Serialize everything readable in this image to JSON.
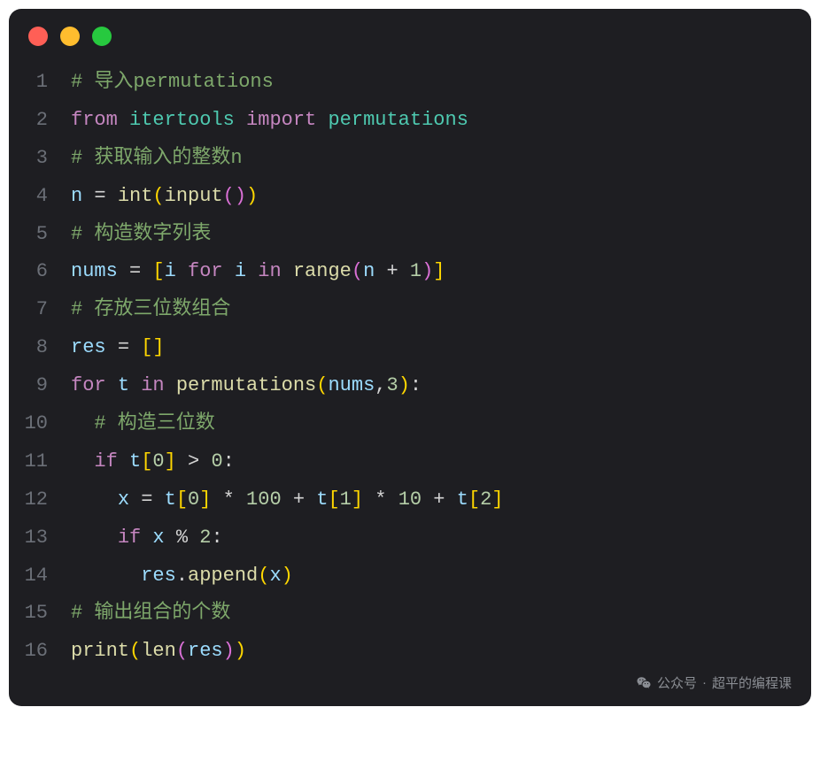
{
  "window": {
    "traffic_lights": [
      "close",
      "minimize",
      "zoom"
    ]
  },
  "watermark": {
    "prefix": "公众号",
    "separator": "·",
    "name": "超平的编程课"
  },
  "code": {
    "lines": [
      {
        "num": "1",
        "tokens": [
          {
            "cls": "tok-comment",
            "text": "# 导入permutations"
          }
        ]
      },
      {
        "num": "2",
        "tokens": [
          {
            "cls": "tok-keyword",
            "text": "from"
          },
          {
            "cls": "tok-default",
            "text": " "
          },
          {
            "cls": "tok-module",
            "text": "itertools"
          },
          {
            "cls": "tok-default",
            "text": " "
          },
          {
            "cls": "tok-keyword",
            "text": "import"
          },
          {
            "cls": "tok-default",
            "text": " "
          },
          {
            "cls": "tok-module",
            "text": "permutations"
          }
        ]
      },
      {
        "num": "3",
        "tokens": [
          {
            "cls": "tok-comment",
            "text": "# 获取输入的整数n"
          }
        ]
      },
      {
        "num": "4",
        "tokens": [
          {
            "cls": "tok-var",
            "text": "n"
          },
          {
            "cls": "tok-default",
            "text": " "
          },
          {
            "cls": "tok-op",
            "text": "="
          },
          {
            "cls": "tok-default",
            "text": " "
          },
          {
            "cls": "tok-builtin",
            "text": "int"
          },
          {
            "cls": "tok-bracket1",
            "text": "("
          },
          {
            "cls": "tok-builtin",
            "text": "input"
          },
          {
            "cls": "tok-bracket2",
            "text": "("
          },
          {
            "cls": "tok-bracket2",
            "text": ")"
          },
          {
            "cls": "tok-bracket1",
            "text": ")"
          }
        ]
      },
      {
        "num": "5",
        "tokens": [
          {
            "cls": "tok-comment",
            "text": "# 构造数字列表"
          }
        ]
      },
      {
        "num": "6",
        "tokens": [
          {
            "cls": "tok-var",
            "text": "nums"
          },
          {
            "cls": "tok-default",
            "text": " "
          },
          {
            "cls": "tok-op",
            "text": "="
          },
          {
            "cls": "tok-default",
            "text": " "
          },
          {
            "cls": "tok-bracket1",
            "text": "["
          },
          {
            "cls": "tok-var",
            "text": "i"
          },
          {
            "cls": "tok-default",
            "text": " "
          },
          {
            "cls": "tok-keyword",
            "text": "for"
          },
          {
            "cls": "tok-default",
            "text": " "
          },
          {
            "cls": "tok-var",
            "text": "i"
          },
          {
            "cls": "tok-default",
            "text": " "
          },
          {
            "cls": "tok-keyword",
            "text": "in"
          },
          {
            "cls": "tok-default",
            "text": " "
          },
          {
            "cls": "tok-builtin",
            "text": "range"
          },
          {
            "cls": "tok-bracket2",
            "text": "("
          },
          {
            "cls": "tok-var",
            "text": "n"
          },
          {
            "cls": "tok-default",
            "text": " "
          },
          {
            "cls": "tok-op",
            "text": "+"
          },
          {
            "cls": "tok-default",
            "text": " "
          },
          {
            "cls": "tok-num",
            "text": "1"
          },
          {
            "cls": "tok-bracket2",
            "text": ")"
          },
          {
            "cls": "tok-bracket1",
            "text": "]"
          }
        ]
      },
      {
        "num": "7",
        "tokens": [
          {
            "cls": "tok-comment",
            "text": "# 存放三位数组合"
          }
        ]
      },
      {
        "num": "8",
        "tokens": [
          {
            "cls": "tok-var",
            "text": "res"
          },
          {
            "cls": "tok-default",
            "text": " "
          },
          {
            "cls": "tok-op",
            "text": "="
          },
          {
            "cls": "tok-default",
            "text": " "
          },
          {
            "cls": "tok-bracket1",
            "text": "["
          },
          {
            "cls": "tok-bracket1",
            "text": "]"
          }
        ]
      },
      {
        "num": "9",
        "tokens": [
          {
            "cls": "tok-keyword",
            "text": "for"
          },
          {
            "cls": "tok-default",
            "text": " "
          },
          {
            "cls": "tok-var",
            "text": "t"
          },
          {
            "cls": "tok-default",
            "text": " "
          },
          {
            "cls": "tok-keyword",
            "text": "in"
          },
          {
            "cls": "tok-default",
            "text": " "
          },
          {
            "cls": "tok-func",
            "text": "permutations"
          },
          {
            "cls": "tok-bracket1",
            "text": "("
          },
          {
            "cls": "tok-var",
            "text": "nums"
          },
          {
            "cls": "tok-punct",
            "text": ","
          },
          {
            "cls": "tok-num",
            "text": "3"
          },
          {
            "cls": "tok-bracket1",
            "text": ")"
          },
          {
            "cls": "tok-punct",
            "text": ":"
          }
        ]
      },
      {
        "num": "10",
        "tokens": [
          {
            "cls": "tok-default",
            "text": "  "
          },
          {
            "cls": "tok-comment",
            "text": "# 构造三位数"
          }
        ]
      },
      {
        "num": "11",
        "tokens": [
          {
            "cls": "tok-default",
            "text": "  "
          },
          {
            "cls": "tok-keyword",
            "text": "if"
          },
          {
            "cls": "tok-default",
            "text": " "
          },
          {
            "cls": "tok-var",
            "text": "t"
          },
          {
            "cls": "tok-bracket1",
            "text": "["
          },
          {
            "cls": "tok-num",
            "text": "0"
          },
          {
            "cls": "tok-bracket1",
            "text": "]"
          },
          {
            "cls": "tok-default",
            "text": " "
          },
          {
            "cls": "tok-op",
            "text": ">"
          },
          {
            "cls": "tok-default",
            "text": " "
          },
          {
            "cls": "tok-num",
            "text": "0"
          },
          {
            "cls": "tok-punct",
            "text": ":"
          }
        ]
      },
      {
        "num": "12",
        "tokens": [
          {
            "cls": "tok-default",
            "text": "    "
          },
          {
            "cls": "tok-var",
            "text": "x"
          },
          {
            "cls": "tok-default",
            "text": " "
          },
          {
            "cls": "tok-op",
            "text": "="
          },
          {
            "cls": "tok-default",
            "text": " "
          },
          {
            "cls": "tok-var",
            "text": "t"
          },
          {
            "cls": "tok-bracket1",
            "text": "["
          },
          {
            "cls": "tok-num",
            "text": "0"
          },
          {
            "cls": "tok-bracket1",
            "text": "]"
          },
          {
            "cls": "tok-default",
            "text": " "
          },
          {
            "cls": "tok-op",
            "text": "*"
          },
          {
            "cls": "tok-default",
            "text": " "
          },
          {
            "cls": "tok-num",
            "text": "100"
          },
          {
            "cls": "tok-default",
            "text": " "
          },
          {
            "cls": "tok-op",
            "text": "+"
          },
          {
            "cls": "tok-default",
            "text": " "
          },
          {
            "cls": "tok-var",
            "text": "t"
          },
          {
            "cls": "tok-bracket1",
            "text": "["
          },
          {
            "cls": "tok-num",
            "text": "1"
          },
          {
            "cls": "tok-bracket1",
            "text": "]"
          },
          {
            "cls": "tok-default",
            "text": " "
          },
          {
            "cls": "tok-op",
            "text": "*"
          },
          {
            "cls": "tok-default",
            "text": " "
          },
          {
            "cls": "tok-num",
            "text": "10"
          },
          {
            "cls": "tok-default",
            "text": " "
          },
          {
            "cls": "tok-op",
            "text": "+"
          },
          {
            "cls": "tok-default",
            "text": " "
          },
          {
            "cls": "tok-var",
            "text": "t"
          },
          {
            "cls": "tok-bracket1",
            "text": "["
          },
          {
            "cls": "tok-num",
            "text": "2"
          },
          {
            "cls": "tok-bracket1",
            "text": "]"
          }
        ]
      },
      {
        "num": "13",
        "tokens": [
          {
            "cls": "tok-default",
            "text": "    "
          },
          {
            "cls": "tok-keyword",
            "text": "if"
          },
          {
            "cls": "tok-default",
            "text": " "
          },
          {
            "cls": "tok-var",
            "text": "x"
          },
          {
            "cls": "tok-default",
            "text": " "
          },
          {
            "cls": "tok-op",
            "text": "%"
          },
          {
            "cls": "tok-default",
            "text": " "
          },
          {
            "cls": "tok-num",
            "text": "2"
          },
          {
            "cls": "tok-punct",
            "text": ":"
          }
        ]
      },
      {
        "num": "14",
        "tokens": [
          {
            "cls": "tok-default",
            "text": "      "
          },
          {
            "cls": "tok-var",
            "text": "res"
          },
          {
            "cls": "tok-punct",
            "text": "."
          },
          {
            "cls": "tok-func",
            "text": "append"
          },
          {
            "cls": "tok-bracket1",
            "text": "("
          },
          {
            "cls": "tok-var",
            "text": "x"
          },
          {
            "cls": "tok-bracket1",
            "text": ")"
          }
        ]
      },
      {
        "num": "15",
        "tokens": [
          {
            "cls": "tok-comment",
            "text": "# 输出组合的个数"
          }
        ]
      },
      {
        "num": "16",
        "tokens": [
          {
            "cls": "tok-builtin",
            "text": "print"
          },
          {
            "cls": "tok-bracket1",
            "text": "("
          },
          {
            "cls": "tok-builtin",
            "text": "len"
          },
          {
            "cls": "tok-bracket2",
            "text": "("
          },
          {
            "cls": "tok-var",
            "text": "res"
          },
          {
            "cls": "tok-bracket2",
            "text": ")"
          },
          {
            "cls": "tok-bracket1",
            "text": ")"
          }
        ]
      }
    ]
  }
}
